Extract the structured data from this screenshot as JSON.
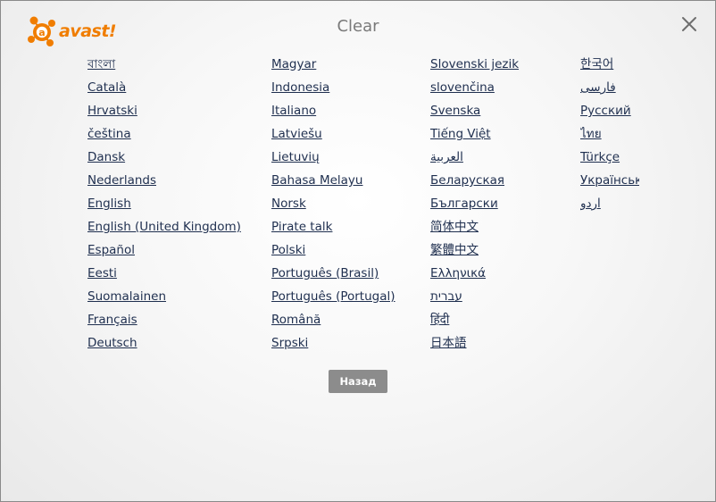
{
  "header": {
    "logo_text": "avast!",
    "title": "Clear"
  },
  "languages": {
    "col1": [
      "বাংলা",
      "Català",
      "Hrvatski",
      "čeština",
      "Dansk",
      "Nederlands",
      "English",
      "English (United Kingdom)",
      "Español",
      "Eesti",
      "Suomalainen",
      "Français",
      "Deutsch"
    ],
    "col2": [
      "Magyar",
      "Indonesia",
      "Italiano",
      "Latviešu",
      "Lietuvių",
      "Bahasa Melayu",
      "Norsk",
      "Pirate talk",
      "Polski",
      "Português (Brasil)",
      "Português (Portugal)",
      "Română",
      "Srpski"
    ],
    "col3": [
      "Slovenski jezik",
      "slovenčina",
      "Svenska",
      "Tiếng Việt",
      "العربية",
      "Беларуская",
      "Български",
      "简体中文",
      "繁體中文",
      "Ελληνικά",
      "עברית",
      "हिंदी",
      "日本語"
    ],
    "col4": [
      "한국어",
      "فارسی",
      "Русский",
      "ไทย",
      "Türkçe",
      "Українська",
      "اردو"
    ]
  },
  "back_button": "Назад",
  "colors": {
    "brand_orange": "#f07d00",
    "link": "#1f2f4f",
    "button": "#8c8c8c"
  },
  "icons": {
    "logo": "avast-logo-icon",
    "close": "close-icon"
  }
}
